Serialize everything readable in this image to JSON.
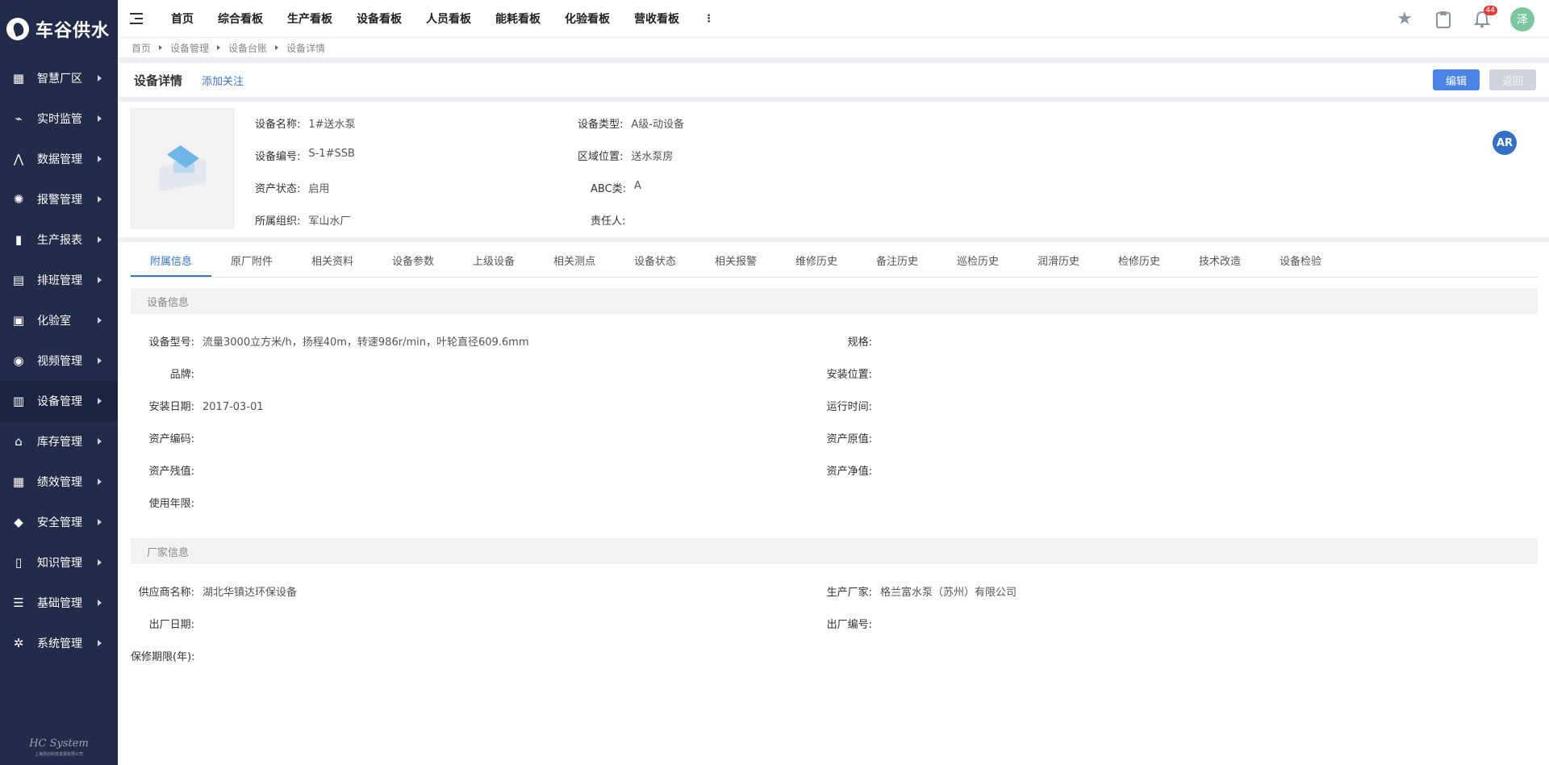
{
  "app": {
    "logo_text": "车谷供水"
  },
  "sidebar": {
    "items": [
      {
        "label": "智慧厂区",
        "icon": "monitor-chart-icon",
        "glyph": "▦"
      },
      {
        "label": "实时监管",
        "icon": "pulse-monitor-icon",
        "glyph": "⌁"
      },
      {
        "label": "数据管理",
        "icon": "line-trend-icon",
        "glyph": "⋀"
      },
      {
        "label": "报警管理",
        "icon": "alarm-light-icon",
        "glyph": "✺"
      },
      {
        "label": "生产报表",
        "icon": "bar-chart-icon",
        "glyph": "▮"
      },
      {
        "label": "排班管理",
        "icon": "schedule-icon",
        "glyph": "▤"
      },
      {
        "label": "化验室",
        "icon": "lab-monitor-icon",
        "glyph": "▣"
      },
      {
        "label": "视频管理",
        "icon": "camera-icon",
        "glyph": "◉"
      },
      {
        "label": "设备管理",
        "icon": "equipment-icon",
        "glyph": "▥"
      },
      {
        "label": "库存管理",
        "icon": "warehouse-icon",
        "glyph": "⌂"
      },
      {
        "label": "绩效管理",
        "icon": "grid-apps-icon",
        "glyph": "▦"
      },
      {
        "label": "安全管理",
        "icon": "shield-icon",
        "glyph": "◆"
      },
      {
        "label": "知识管理",
        "icon": "book-icon",
        "glyph": "▯"
      },
      {
        "label": "基础管理",
        "icon": "list-icon",
        "glyph": "☰"
      },
      {
        "label": "系统管理",
        "icon": "gear-icon",
        "glyph": "✲"
      }
    ],
    "active_index": 8,
    "footer_title": "HC System",
    "footer_sub": "上海慧创科技发展有限公司"
  },
  "topbar": {
    "tabs": [
      "首页",
      "综合看板",
      "生产看板",
      "设备看板",
      "人员看板",
      "能耗看板",
      "化验看板",
      "营收看板"
    ],
    "more": "⋮",
    "notification_count": "44",
    "avatar_text": "泽"
  },
  "breadcrumb": [
    "首页",
    "设备管理",
    "设备台账",
    "设备详情"
  ],
  "header": {
    "title": "设备详情",
    "follow_label": "添加关注",
    "edit_label": "编辑",
    "back_label": "返回"
  },
  "equipment": {
    "name_label": "设备名称:",
    "name": "1#送水泵",
    "type_label": "设备类型:",
    "type": "A级-动设备",
    "code_label": "设备编号:",
    "code": "S-1#SSB",
    "area_label": "区域位置:",
    "area": "送水泵房",
    "status_label": "资产状态:",
    "status": "启用",
    "abc_label": "ABC类:",
    "abc": "A",
    "org_label": "所属组织:",
    "org": "军山水厂",
    "owner_label": "责任人:",
    "owner": "",
    "ar_label": "AR"
  },
  "detail_tabs": [
    "附属信息",
    "原厂附件",
    "相关资料",
    "设备参数",
    "上级设备",
    "相关测点",
    "设备状态",
    "相关报警",
    "维修历史",
    "备注历史",
    "巡检历史",
    "润滑历史",
    "检修历史",
    "技术改造",
    "设备检验"
  ],
  "device_info": {
    "title": "设备信息",
    "model_label": "设备型号:",
    "model": "流量3000立方米/h，扬程40m，转速986r/min，叶轮直径609.6mm",
    "spec_label": "规格:",
    "spec": "",
    "brand_label": "品牌:",
    "brand": "",
    "install_pos_label": "安装位置:",
    "install_pos": "",
    "install_date_label": "安装日期:",
    "install_date": "2017-03-01",
    "runtime_label": "运行时间:",
    "runtime": "",
    "asset_code_label": "资产编码:",
    "asset_code": "",
    "orig_value_label": "资产原值:",
    "orig_value": "",
    "residual_label": "资产残值:",
    "residual": "",
    "net_value_label": "资产净值:",
    "net_value": "",
    "life_label": "使用年限:",
    "life": ""
  },
  "vendor_info": {
    "title": "厂家信息",
    "supplier_label": "供应商名称:",
    "supplier": "湖北华镇达环保设备",
    "manufacturer_label": "生产厂家:",
    "manufacturer": "格兰富水泵（苏州）有限公司",
    "mfg_date_label": "出厂日期:",
    "mfg_date": "",
    "mfg_no_label": "出厂编号:",
    "mfg_no": "",
    "warranty_label": "保修期限(年):",
    "warranty": ""
  }
}
